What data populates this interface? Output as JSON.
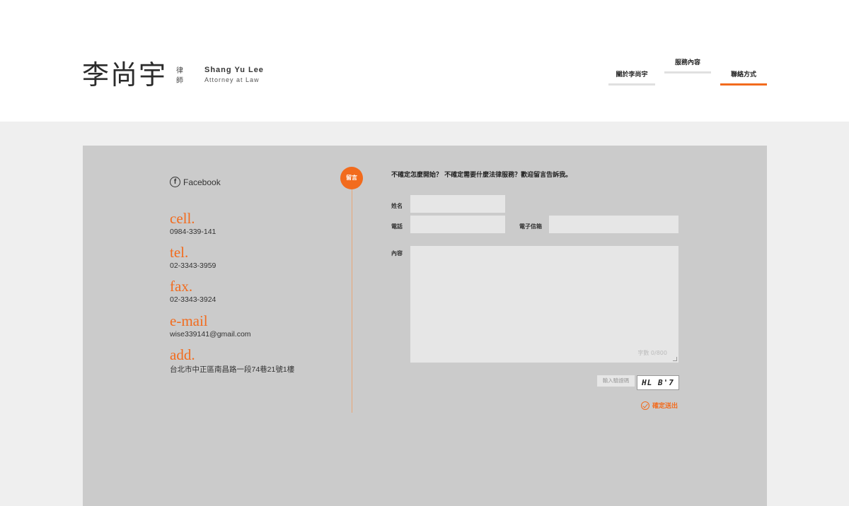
{
  "header": {
    "logo_cn": "李尚宇",
    "logo_title_cn": "律師",
    "logo_en_name": "Shang Yu Lee",
    "logo_en_sub": "Attorney at Law",
    "nav": [
      {
        "label": "關於李尚宇",
        "active": false
      },
      {
        "label": "服務內容",
        "active": false
      },
      {
        "label": "聯絡方式",
        "active": true
      }
    ]
  },
  "contact": {
    "facebook_label": "Facebook",
    "items": [
      {
        "label": "cell.",
        "value": "0984-339-141"
      },
      {
        "label": "tel.",
        "value": "02-3343-3959"
      },
      {
        "label": "fax.",
        "value": "02-3343-3924"
      },
      {
        "label": "e-mail",
        "value": "wise339141@gmail.com"
      },
      {
        "label": "add.",
        "value": "台北市中正區南昌路一段74巷21號1樓"
      }
    ]
  },
  "form": {
    "badge": "留言",
    "intro": "不確定怎麼開始？ 不確定需要什麼法律服務？歡迎留言告訴我。",
    "name_label": "姓名",
    "phone_label": "電話",
    "email_label": "電子信箱",
    "content_label": "內容",
    "counter": "字數 0/800",
    "captcha_placeholder": "輸入驗證碼",
    "captcha_text": "HL B'7",
    "submit_label": "確定送出"
  },
  "colors": {
    "accent": "#f26b1d",
    "panel": "#cbcbcb",
    "field": "#e6e6e6"
  }
}
